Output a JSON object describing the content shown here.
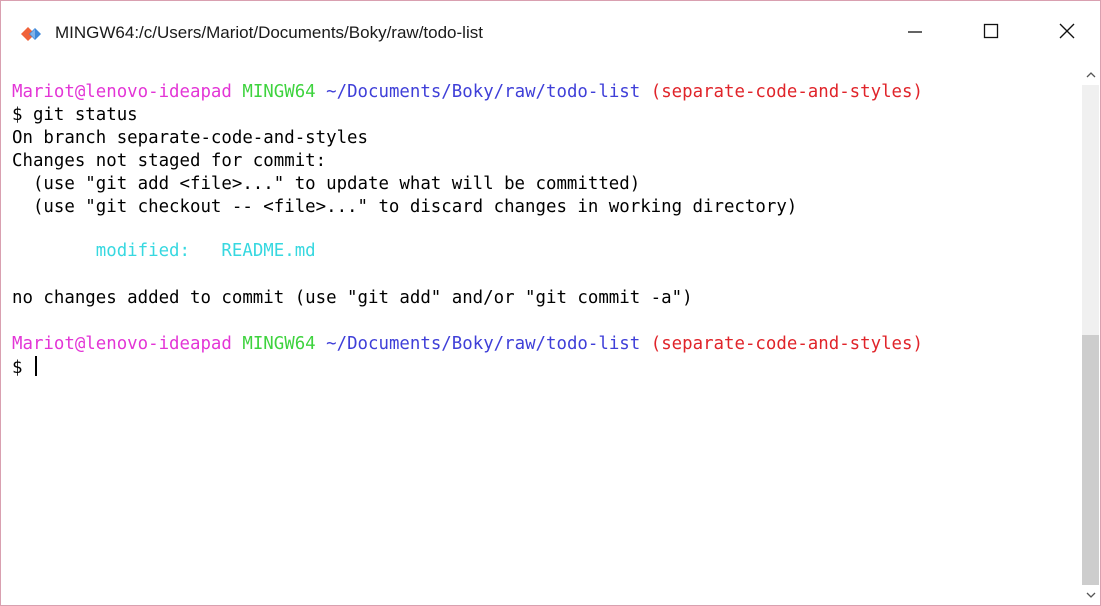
{
  "window": {
    "title": "MINGW64:/c/Users/Mariot/Documents/Boky/raw/todo-list",
    "icon": "git-bash-icon",
    "controls": [
      "minimize-icon",
      "maximize-icon",
      "close-icon"
    ]
  },
  "terminal": {
    "prompt1": {
      "user": "Mariot@lenovo-ideapad",
      "host": "MINGW64",
      "path": "~/Documents/Boky/raw/todo-list",
      "branch": "(separate-code-and-styles)"
    },
    "command": "$ git status",
    "out1": "On branch separate-code-and-styles",
    "out2": "Changes not staged for commit:",
    "out3": "  (use \"git add <file>...\" to update what will be committed)",
    "out4": "  (use \"git checkout -- <file>...\" to discard changes in working directory)",
    "modified_label": "modified:",
    "modified_file": "README.md",
    "out5": "no changes added to commit (use \"git add\" and/or \"git commit -a\")",
    "prompt2": {
      "user": "Mariot@lenovo-ideapad",
      "host": "MINGW64",
      "path": "~/Documents/Boky/raw/todo-list",
      "branch": "(separate-code-and-styles)"
    },
    "input_prompt": "$ "
  },
  "colors": {
    "user": "#e335d6",
    "host": "#3ed33e",
    "path": "#3f3fd8",
    "branch": "#e0242a",
    "modified": "#37d8e0"
  }
}
